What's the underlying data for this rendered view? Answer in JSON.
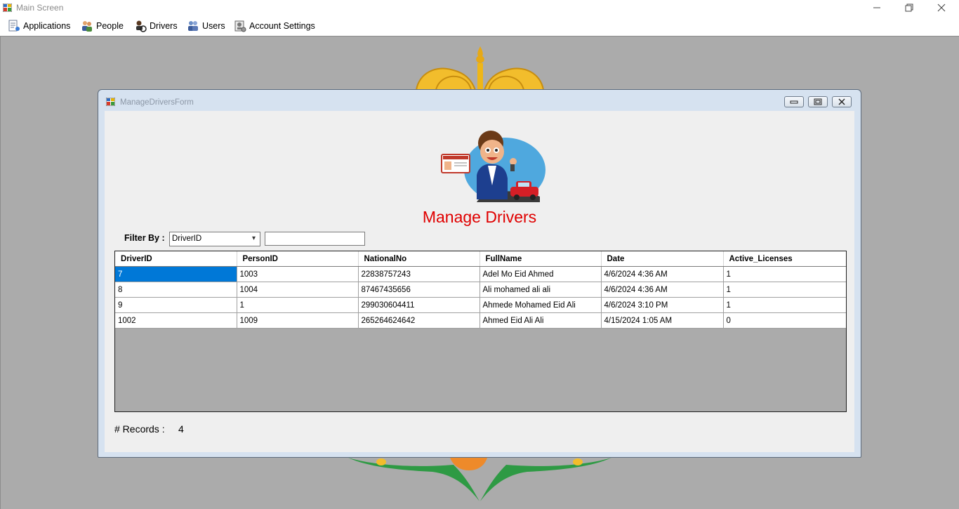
{
  "window": {
    "title": "Main Screen",
    "minimize_icon": "minimize-icon",
    "restore_icon": "restore-icon",
    "close_icon": "close-icon"
  },
  "menu": {
    "items": [
      {
        "label": "Applications",
        "icon": "applications-icon"
      },
      {
        "label": "People",
        "icon": "people-icon"
      },
      {
        "label": "Drivers",
        "icon": "drivers-icon"
      },
      {
        "label": "Users",
        "icon": "users-icon"
      },
      {
        "label": "Account Settings",
        "icon": "account-settings-icon"
      }
    ]
  },
  "child_form": {
    "title": "ManageDriversForm",
    "heading": "Manage Drivers",
    "filter_label": "Filter By :",
    "filter_selected": "DriverID",
    "filter_text": "",
    "columns": [
      "DriverID",
      "PersonID",
      "NationalNo",
      "FullName",
      "Date",
      "Active_Licenses"
    ],
    "rows": [
      [
        "7",
        "1003",
        "22838757243",
        "Adel Mo Eid Ahmed",
        "4/6/2024 4:36 AM",
        "1"
      ],
      [
        "8",
        "1004",
        "87467435656",
        "Ali mohamed ali ali",
        "4/6/2024 4:36 AM",
        "1"
      ],
      [
        "9",
        "1",
        "299030604411",
        "Ahmede Mohamed Eid Ali",
        "4/6/2024 3:10 PM",
        "1"
      ],
      [
        "1002",
        "1009",
        "265264624642",
        "Ahmed Eid Ali Ali",
        "4/15/2024 1:05 AM",
        "0"
      ]
    ],
    "records_label": "# Records :",
    "records_count": "4"
  },
  "colors": {
    "heading": "#e00000",
    "selection": "#0078d7",
    "workspace": "#ababab"
  }
}
